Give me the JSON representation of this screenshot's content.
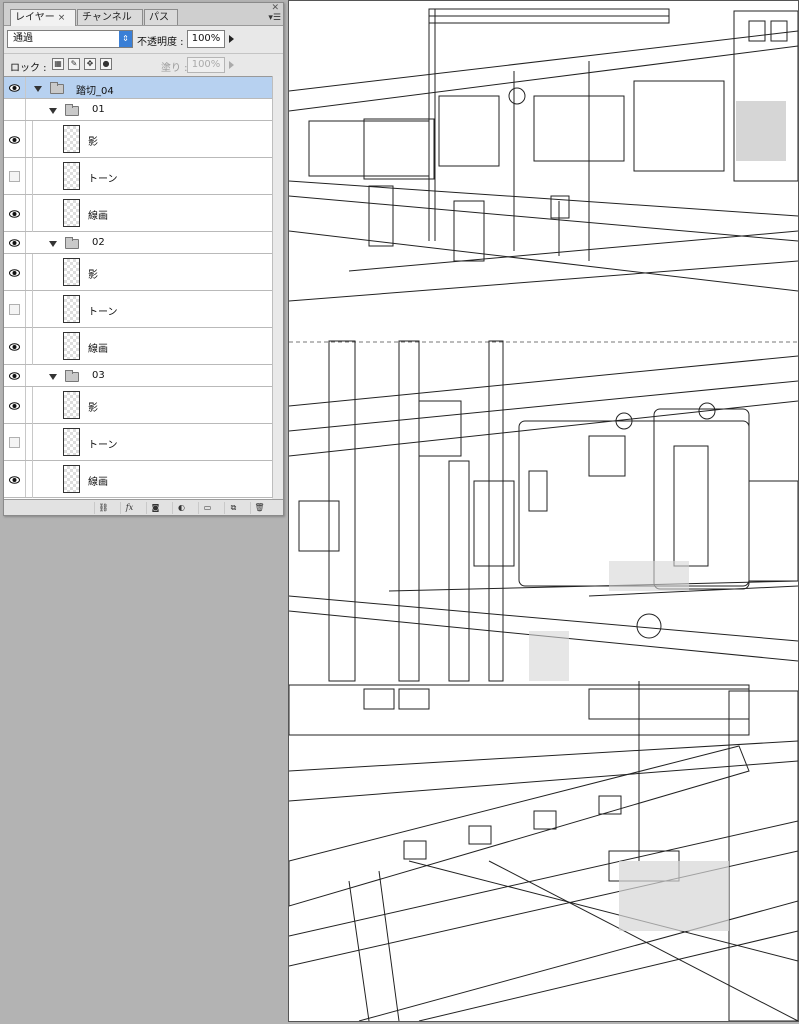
{
  "panel": {
    "tabs": [
      {
        "label": "レイヤー",
        "active": true
      },
      {
        "label": "チャンネル",
        "active": false
      },
      {
        "label": "パス",
        "active": false
      }
    ],
    "blend_mode": "通過",
    "opacity_label": "不透明度 :",
    "opacity_value": "100%",
    "lock_label": "ロック :",
    "fill_label": "塗り :",
    "fill_value": "100%"
  },
  "layers": {
    "group": {
      "name": "踏切_04",
      "visible": true,
      "selected": true
    },
    "subgroups": [
      {
        "name": "01",
        "visible": false,
        "layers": [
          {
            "name": "影",
            "visible": true
          },
          {
            "name": "トーン",
            "visible": false
          },
          {
            "name": "線画",
            "visible": true
          }
        ]
      },
      {
        "name": "02",
        "visible": true,
        "layers": [
          {
            "name": "影",
            "visible": true
          },
          {
            "name": "トーン",
            "visible": false
          },
          {
            "name": "線画",
            "visible": true
          }
        ]
      },
      {
        "name": "03",
        "visible": true,
        "layers": [
          {
            "name": "影",
            "visible": true
          },
          {
            "name": "トーン",
            "visible": false
          },
          {
            "name": "線画",
            "visible": true
          }
        ]
      }
    ]
  },
  "footer_buttons": [
    {
      "icon": "link-icon",
      "label": "⛓"
    },
    {
      "icon": "fx-icon",
      "label": "fx"
    },
    {
      "icon": "mask-icon",
      "label": "◙"
    },
    {
      "icon": "adjustment-icon",
      "label": "◐"
    },
    {
      "icon": "new-group-icon",
      "label": "▭"
    },
    {
      "icon": "new-layer-icon",
      "label": "⧉"
    },
    {
      "icon": "trash-icon",
      "label": "🗑"
    }
  ],
  "colors": {
    "selected_row": "#b7d1f0",
    "blend_arrow": "#3a7fd6",
    "workspace": "#b3b3b3"
  }
}
